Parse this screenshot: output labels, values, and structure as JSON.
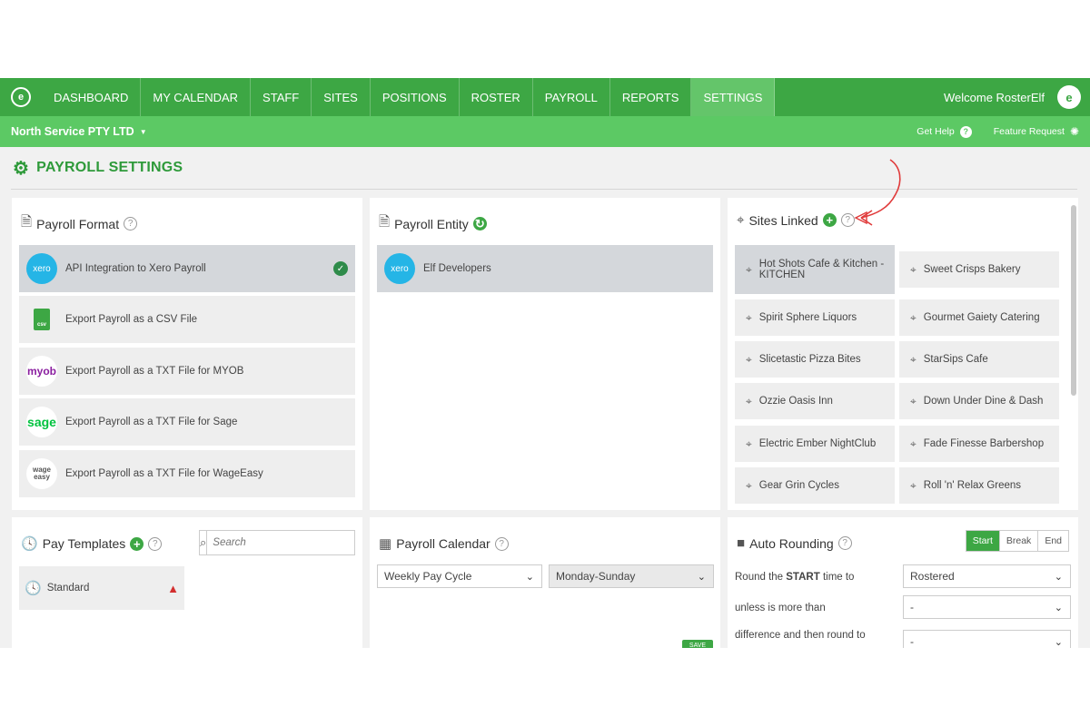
{
  "nav": {
    "items": [
      "DASHBOARD",
      "MY CALENDAR",
      "STAFF",
      "SITES",
      "POSITIONS",
      "ROSTER",
      "PAYROLL",
      "REPORTS",
      "SETTINGS"
    ],
    "active": "SETTINGS",
    "welcome": "Welcome RosterElf"
  },
  "subnav": {
    "company": "North Service PTY LTD",
    "get_help": "Get Help",
    "feature_request": "Feature Request"
  },
  "page": {
    "title": "PAYROLL SETTINGS"
  },
  "payroll_format": {
    "title": "Payroll Format",
    "options": [
      {
        "label": "API Integration to Xero Payroll",
        "logo": "xero",
        "selected": true
      },
      {
        "label": "Export Payroll as a CSV File",
        "logo": "csv",
        "selected": false
      },
      {
        "label": "Export Payroll as a TXT File for MYOB",
        "logo": "myob",
        "selected": false
      },
      {
        "label": "Export Payroll as a TXT File for Sage",
        "logo": "sage",
        "selected": false
      },
      {
        "label": "Export Payroll as a TXT File for WageEasy",
        "logo": "wage easy",
        "selected": false
      }
    ],
    "logo_text": {
      "xero": "xero",
      "csv": "csv",
      "myob": "myob",
      "sage": "sage",
      "wage1": "wage",
      "wage2": "easy"
    }
  },
  "payroll_entity": {
    "title": "Payroll Entity",
    "entity": "Elf Developers",
    "logo_text": "xero"
  },
  "sites_linked": {
    "title": "Sites Linked",
    "sites": [
      "Hot Shots Cafe & Kitchen - KITCHEN",
      "Sweet Crisps Bakery",
      "Spirit Sphere Liquors",
      "Gourmet Gaiety Catering",
      "Slicetastic Pizza Bites",
      "StarSips Cafe",
      "Ozzie Oasis Inn",
      "Down Under Dine & Dash",
      "Electric Ember NightClub",
      "Fade Finesse Barbershop",
      "Gear Grin Cycles",
      "Roll 'n' Relax Greens"
    ]
  },
  "pay_templates": {
    "title": "Pay Templates",
    "search_placeholder": "Search",
    "templates": [
      "Standard"
    ]
  },
  "payroll_calendar": {
    "title": "Payroll Calendar",
    "cycle": "Weekly Pay Cycle",
    "week": "Monday-Sunday",
    "save": "SAVE"
  },
  "auto_rounding": {
    "title": "Auto Rounding",
    "tabs": [
      "Start",
      "Break",
      "End"
    ],
    "active_tab": "Start",
    "row1_prefix": "Round the ",
    "row1_bold": "START",
    "row1_suffix": " time to",
    "row1_value": "Rostered",
    "row2_label": "unless is more than",
    "row2_value": "-",
    "row3_label": "difference and then round to",
    "row3_value": "-"
  },
  "colors": {
    "primary": "#3da744",
    "subnav": "#5cc964",
    "xero": "#25b5e6",
    "warning": "#d32f2f"
  }
}
